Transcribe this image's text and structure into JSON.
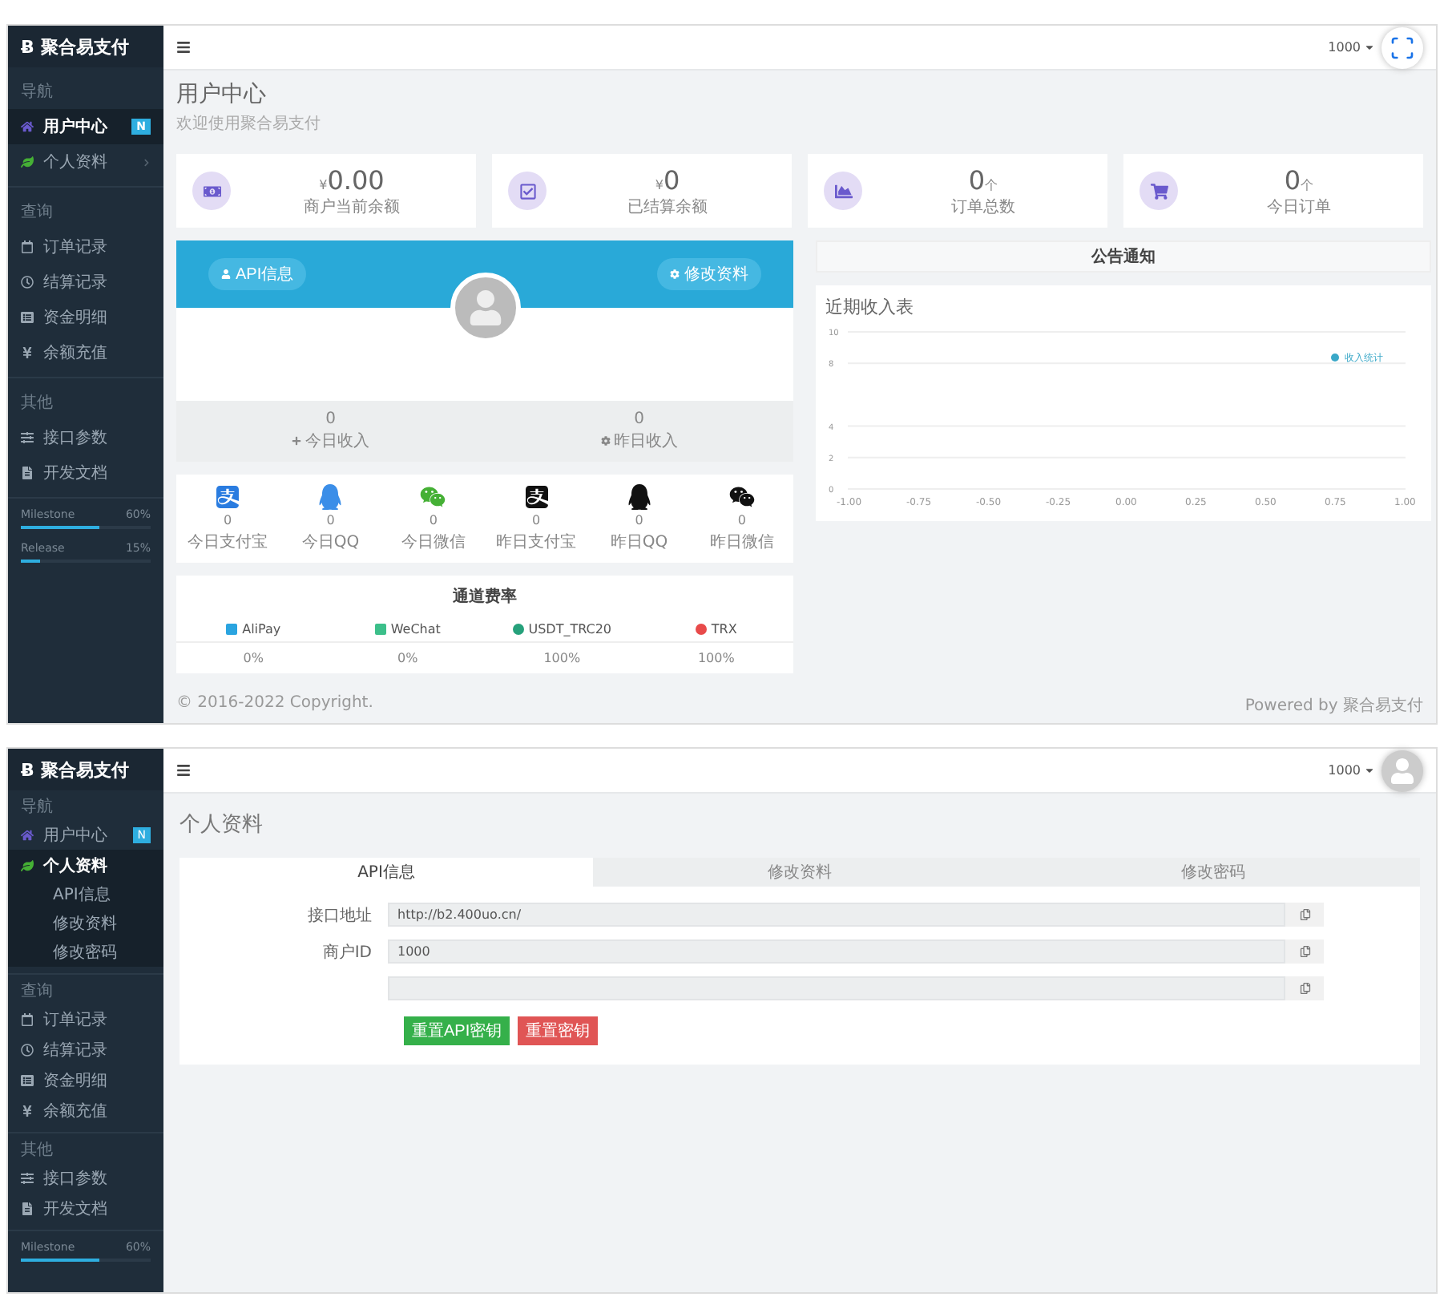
{
  "screens": [
    {
      "kind": "dashboard",
      "sidebar": {
        "logo_mark": "Ƀ",
        "brand": "聚合易支付",
        "sections": [
          {
            "heading": "导航",
            "items": [
              {
                "label": "用户中心",
                "selected": true,
                "badge": "N"
              },
              {
                "label": "个人资料",
                "selected": false,
                "expanded": false
              }
            ]
          },
          {
            "heading": "查询",
            "items": [
              {
                "label": "订单记录",
                "selected": false
              },
              {
                "label": "结算记录",
                "selected": false
              },
              {
                "label": "资金明细",
                "selected": false
              },
              {
                "label": "余额充值",
                "selected": false
              }
            ]
          },
          {
            "heading": "其他",
            "items": [
              {
                "label": "接口参数",
                "selected": false
              },
              {
                "label": "开发文档",
                "selected": false
              }
            ]
          }
        ],
        "progress": [
          {
            "label": "Milestone",
            "reading": "60%",
            "level": 0.6
          },
          {
            "label": "Release",
            "reading": "15%",
            "level": 0.15
          }
        ]
      },
      "header": {
        "user": "1000"
      },
      "page_title": "用户中心",
      "page_subtitle": "欢迎使用聚合易支付",
      "stat_cards": [
        {
          "prefix": "¥",
          "value": "0.00",
          "label": "商户当前余额"
        },
        {
          "prefix": "¥",
          "value": "0",
          "label": "已结算余额"
        },
        {
          "value": "0",
          "suffix": "个",
          "label": "订单总数"
        },
        {
          "value": "0",
          "suffix": "个",
          "label": "今日订单"
        }
      ],
      "profile": {
        "buttons": [
          "API信息",
          "修改资料"
        ],
        "income": [
          {
            "value": "0",
            "label": "今日收入"
          },
          {
            "value": "0",
            "label": "昨日收入"
          }
        ]
      },
      "channel_stats": [
        {
          "kind": "alipay",
          "color": "#2a7ce0",
          "value": "0",
          "label": "今日支付宝"
        },
        {
          "kind": "qq",
          "color": "#3b8ee8",
          "value": "0",
          "label": "今日QQ"
        },
        {
          "kind": "wechat",
          "color": "#45b035",
          "value": "0",
          "label": "今日微信"
        },
        {
          "kind": "alipay",
          "color": "#111111",
          "value": "0",
          "label": "昨日支付宝"
        },
        {
          "kind": "qq",
          "color": "#111111",
          "value": "0",
          "label": "昨日QQ"
        },
        {
          "kind": "wechat",
          "color": "#111111",
          "value": "0",
          "label": "昨日微信"
        }
      ],
      "rates": {
        "title": "通道费率",
        "channels": [
          {
            "name": "AliPay",
            "rate": "0%",
            "color": "#2aa4e0"
          },
          {
            "name": "WeChat",
            "rate": "0%",
            "color": "#3cbf8a"
          },
          {
            "name": "USDT_TRC20",
            "rate": "100%",
            "color": "#26a17b"
          },
          {
            "name": "TRX",
            "rate": "100%",
            "color": "#e84a4a"
          }
        ]
      },
      "notice": {
        "title": "公告通知"
      },
      "chart": {
        "title": "近期收入表",
        "chart_data": {
          "type": "line",
          "grid": true,
          "ylim": [
            0,
            10
          ],
          "categories": [
            "-1.00",
            "-0.75",
            "-0.50",
            "-0.25",
            "0.00",
            "0.25",
            "0.50",
            "0.75",
            "1.00"
          ],
          "yticks": [
            0,
            2,
            4,
            8,
            10
          ],
          "series": [
            {
              "name": "收入统计",
              "color": "#3aa8c8",
              "values": [
                null,
                null,
                null,
                null,
                null,
                null,
                null,
                null,
                null
              ]
            }
          ]
        }
      },
      "footer": {
        "copyright": "© 2016-2022 Copyright.",
        "powered": "Powered by 聚合易支付"
      }
    },
    {
      "kind": "profile",
      "sidebar": {
        "logo_mark": "Ƀ",
        "brand": "聚合易支付",
        "sections": [
          {
            "heading": "导航",
            "items": [
              {
                "label": "用户中心",
                "selected": false,
                "badge": "N"
              },
              {
                "label": "个人资料",
                "selected": true,
                "expanded": true,
                "children": [
                  {
                    "label": "API信息"
                  },
                  {
                    "label": "修改资料"
                  },
                  {
                    "label": "修改密码"
                  }
                ]
              }
            ]
          },
          {
            "heading": "查询",
            "items": [
              {
                "label": "订单记录",
                "selected": false
              },
              {
                "label": "结算记录",
                "selected": false
              },
              {
                "label": "资金明细",
                "selected": false
              },
              {
                "label": "余额充值",
                "selected": false
              }
            ]
          },
          {
            "heading": "其他",
            "items": [
              {
                "label": "接口参数",
                "selected": false
              },
              {
                "label": "开发文档",
                "selected": false
              }
            ]
          }
        ],
        "progress": [
          {
            "label": "Milestone",
            "reading": "60%",
            "level": 0.6
          }
        ]
      },
      "header": {
        "user": "1000"
      },
      "page_title": "个人资料",
      "tabs": [
        {
          "label": "API信息",
          "selected": true
        },
        {
          "label": "修改资料",
          "selected": false
        },
        {
          "label": "修改密码",
          "selected": false
        }
      ],
      "form": [
        {
          "kind": "text",
          "label": "接口地址",
          "value": "http://b2.400uo.cn/"
        },
        {
          "kind": "text",
          "label": "商户ID",
          "value": "1000"
        },
        {
          "kind": "masked"
        }
      ],
      "buttons": [
        {
          "kind": "primary",
          "label": "重置API密钥"
        },
        {
          "kind": "danger",
          "label": "重置密钥"
        }
      ]
    }
  ]
}
